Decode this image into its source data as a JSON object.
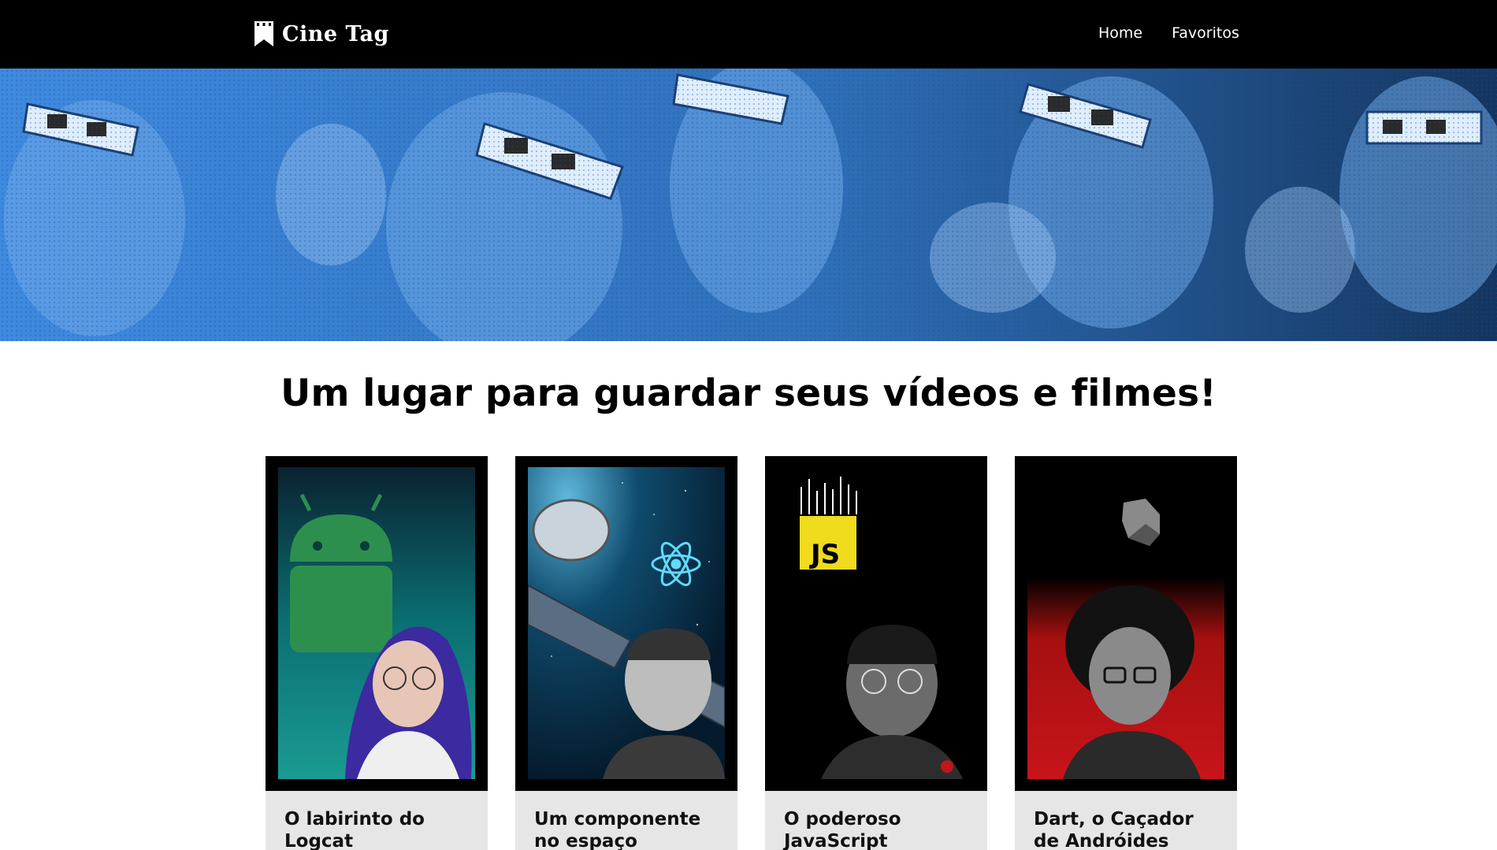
{
  "header": {
    "logo_text": "Cine Tag",
    "nav": [
      {
        "label": "Home"
      },
      {
        "label": "Favoritos"
      }
    ]
  },
  "banner": {
    "description_icon": "audience-3d-glasses-image",
    "tint_color": "#3e86d8"
  },
  "main": {
    "title": "Um lugar para guardar seus vídeos e filmes!"
  },
  "cards": [
    {
      "title": "O labirinto do Logcat",
      "theme_color": "#0f8f8a",
      "icon": "android-icon"
    },
    {
      "title": "Um componente no espaço",
      "theme_color": "#0d3a57",
      "icon": "react-icon"
    },
    {
      "title": "O poderoso JavaScript",
      "theme_color": "#000000",
      "icon": "javascript-icon"
    },
    {
      "title": "Dart, o Caçador de Andróides",
      "theme_color": "#b51414",
      "icon": "dart-icon"
    }
  ]
}
